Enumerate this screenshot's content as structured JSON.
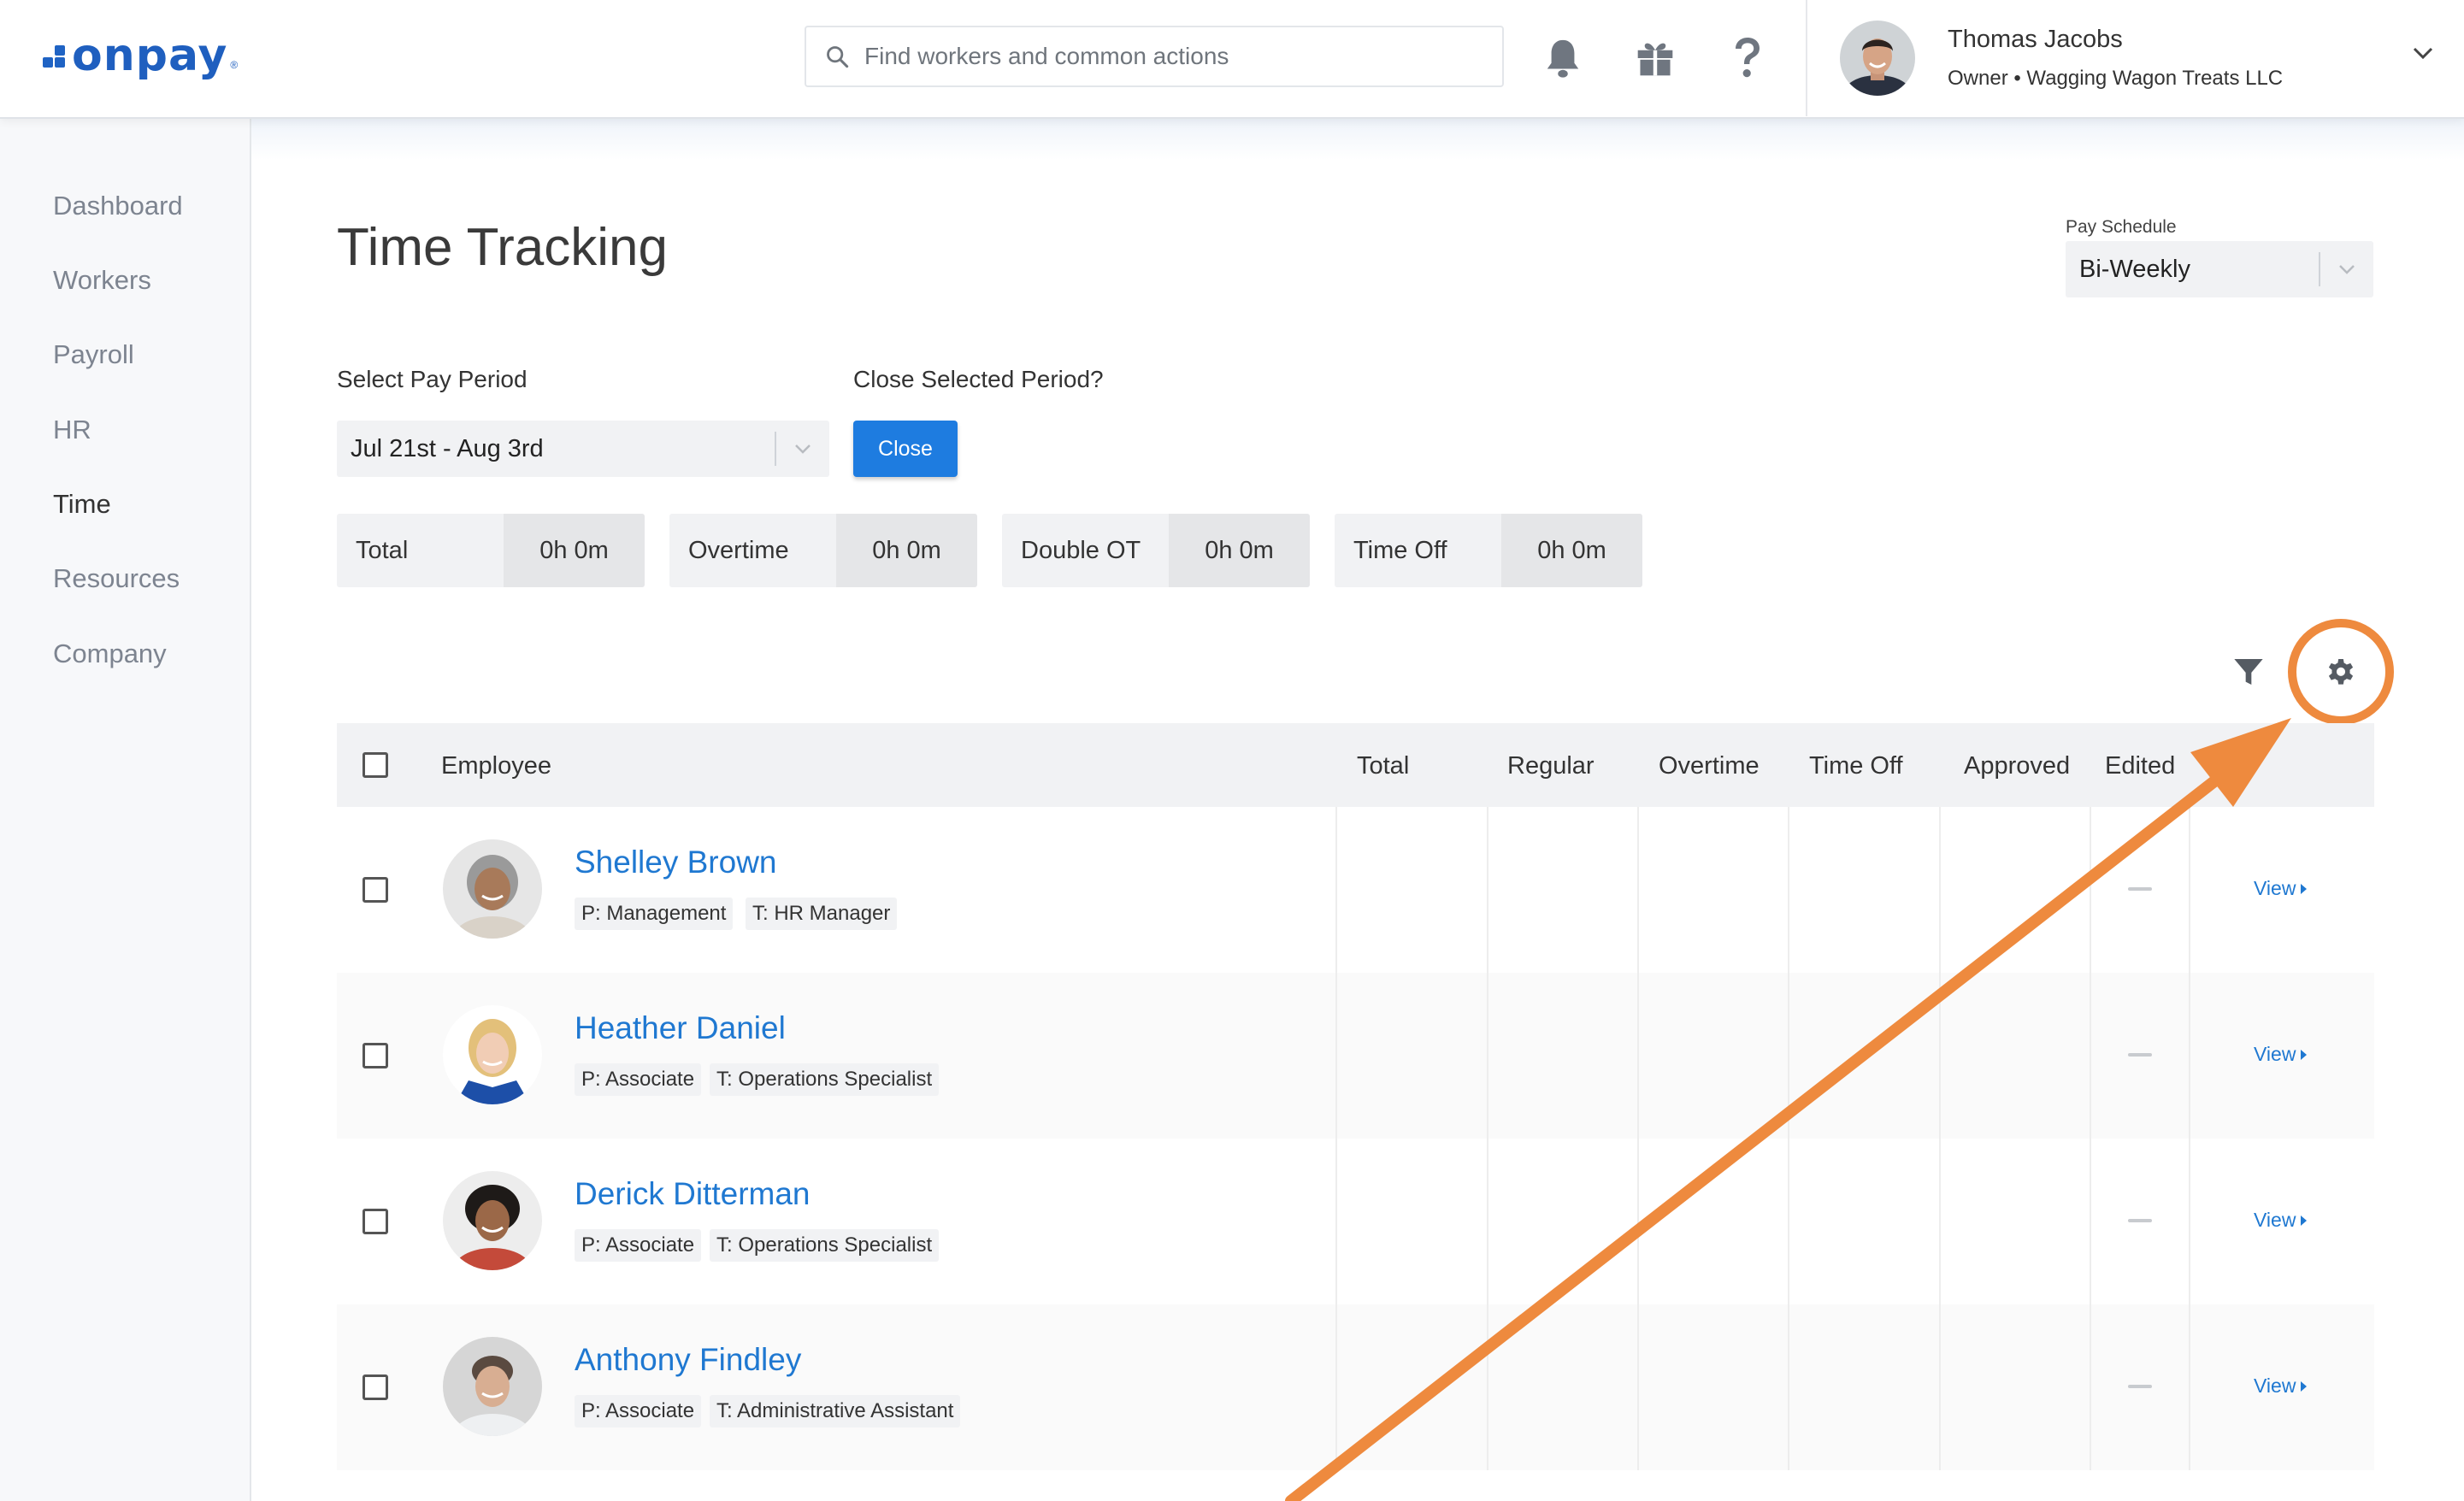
{
  "brand": {
    "logo_text": "onpay",
    "logo_mark": "®",
    "accent_color": "#1f63c4"
  },
  "header": {
    "search_placeholder": "Find workers and common actions",
    "icons": [
      "bell-icon",
      "gift-icon",
      "help-icon"
    ],
    "user": {
      "name": "Thomas Jacobs",
      "role_org": "Owner • Wagging Wagon Treats LLC"
    }
  },
  "sidebar": {
    "items": [
      {
        "label": "Dashboard",
        "active": false
      },
      {
        "label": "Workers",
        "active": false
      },
      {
        "label": "Payroll",
        "active": false
      },
      {
        "label": "HR",
        "active": false
      },
      {
        "label": "Time",
        "active": true
      },
      {
        "label": "Resources",
        "active": false
      },
      {
        "label": "Company",
        "active": false
      }
    ]
  },
  "page": {
    "title": "Time Tracking",
    "pay_schedule": {
      "label": "Pay Schedule",
      "value": "Bi-Weekly"
    },
    "pay_period": {
      "label": "Select Pay Period",
      "value": "Jul 21st - Aug 3rd"
    },
    "close_period": {
      "label": "Close Selected Period?",
      "button": "Close"
    },
    "summary": [
      {
        "label": "Total",
        "value": "0h 0m"
      },
      {
        "label": "Overtime",
        "value": "0h 0m"
      },
      {
        "label": "Double OT",
        "value": "0h 0m"
      },
      {
        "label": "Time Off",
        "value": "0h 0m"
      }
    ],
    "tool_icons": [
      "filter-icon",
      "gear-icon"
    ],
    "annotation_color": "#ee8a3e"
  },
  "table": {
    "columns": [
      "Employee",
      "Total",
      "Regular",
      "Overtime",
      "Time Off",
      "Approved",
      "Edited"
    ],
    "view_label": "View",
    "rows": [
      {
        "name": "Shelley Brown",
        "position": "P: Management",
        "title": "T: HR Manager"
      },
      {
        "name": "Heather Daniel",
        "position": "P: Associate",
        "title": "T: Operations Specialist"
      },
      {
        "name": "Derick Ditterman",
        "position": "P: Associate",
        "title": "T: Operations Specialist"
      },
      {
        "name": "Anthony Findley",
        "position": "P: Associate",
        "title": "T: Administrative Assistant"
      }
    ]
  }
}
